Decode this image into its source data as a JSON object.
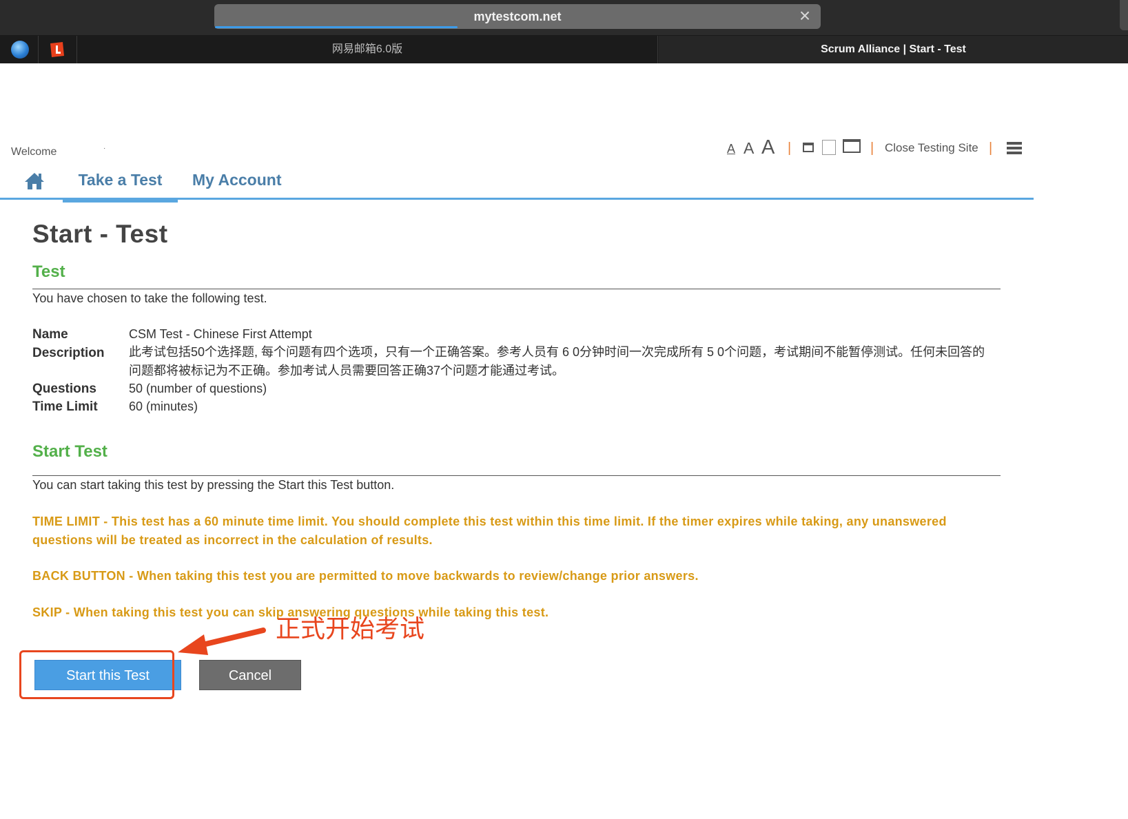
{
  "browser": {
    "url": "mytestcom.net",
    "tabs": [
      {
        "label": "网易邮箱6.0版"
      },
      {
        "label": "Scrum Alliance | Start - Test"
      }
    ]
  },
  "header": {
    "welcome": "Welcome",
    "text_size_labels": [
      "A",
      "A",
      "A"
    ],
    "close_site": "Close Testing Site"
  },
  "nav": {
    "items": [
      {
        "label": "Take a Test"
      },
      {
        "label": "My Account"
      }
    ]
  },
  "main": {
    "title": "Start - Test",
    "test_section": {
      "heading": "Test",
      "intro": "You have chosen to take the following test.",
      "fields": [
        {
          "label": "Name",
          "value": "CSM Test - Chinese First Attempt"
        },
        {
          "label": "Description",
          "value": "此考试包括50个选择题, 每个问题有四个选项，只有一个正确答案。参考人员有 6 0分钟时间一次完成所有 5 0个问题，考试期间不能暂停测试。任何未回答的问题都将被标记为不正确。参加考试人员需要回答正确37个问题才能通过考试。"
        },
        {
          "label": "Questions",
          "value": "50 (number of questions)"
        },
        {
          "label": "Time Limit",
          "value": "60 (minutes)"
        }
      ]
    },
    "start_section": {
      "heading": "Start Test",
      "intro": "You can start taking this test by pressing the Start this Test button.",
      "warnings": [
        "TIME LIMIT - This test has a 60 minute time limit. You should complete this test within this time limit. If the timer expires while taking, any unanswered questions will be treated as incorrect in the calculation of results.",
        "BACK BUTTON - When taking this test you are permitted to move backwards to review/change prior answers.",
        "SKIP - When taking this test you can skip answering questions while taking this test."
      ]
    },
    "buttons": {
      "start": "Start this Test",
      "cancel": "Cancel"
    }
  },
  "annotation": {
    "text": "正式开始考试",
    "color": "#e8461e"
  }
}
